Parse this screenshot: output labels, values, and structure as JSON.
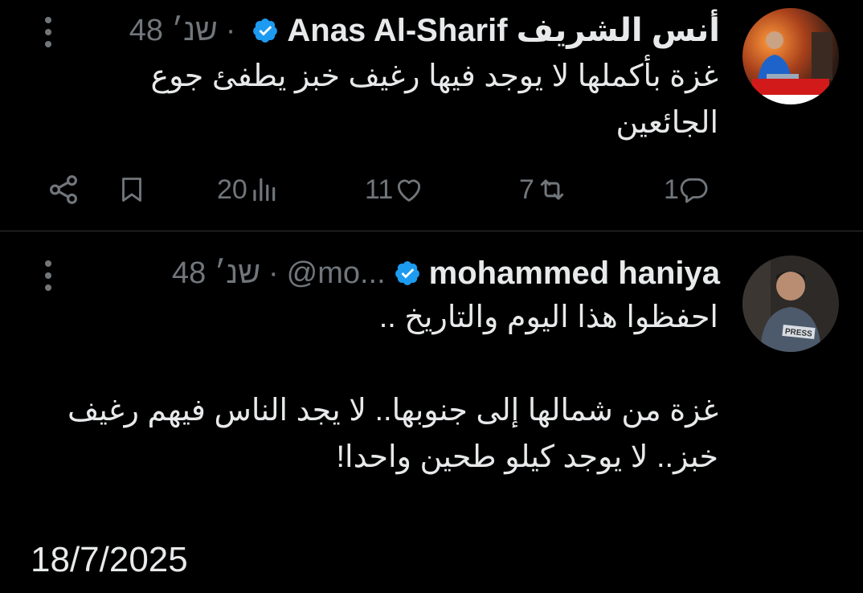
{
  "tweets": [
    {
      "display_name": "Anas Al-Sharif أنس الشريف",
      "handle": "",
      "separator": "·",
      "time": "48 שנ׳",
      "text": "غزة بأكملها لا يوجد فيها رغيف خبز يطفئ جوع الجائعين",
      "stats": {
        "replies": "1",
        "retweets": "7",
        "likes": "11",
        "views": "20"
      }
    },
    {
      "display_name": "mohammed haniya",
      "handle": "@mo...",
      "separator": "·",
      "time": "48 שנ׳",
      "text_line1": "احفظوا هذا اليوم والتاريخ ..",
      "text_line2": "غزة من شمالها إلى جنوبها.. لا يجد الناس فيهم رغيف خبز.. لا يوجد كيلو طحين واحدا!"
    }
  ],
  "date_caption": "18/7/2025",
  "colors": {
    "background": "#000000",
    "text": "#e7e9ea",
    "muted": "#71767b",
    "verified": "#1d9bf0",
    "divider": "#2f3336"
  },
  "icons": {
    "verified": "verified-badge-icon",
    "more": "more-dots-icon",
    "reply": "reply-icon",
    "retweet": "retweet-icon",
    "like": "heart-icon",
    "views": "views-chart-icon",
    "bookmark": "bookmark-icon",
    "share": "share-icon"
  }
}
